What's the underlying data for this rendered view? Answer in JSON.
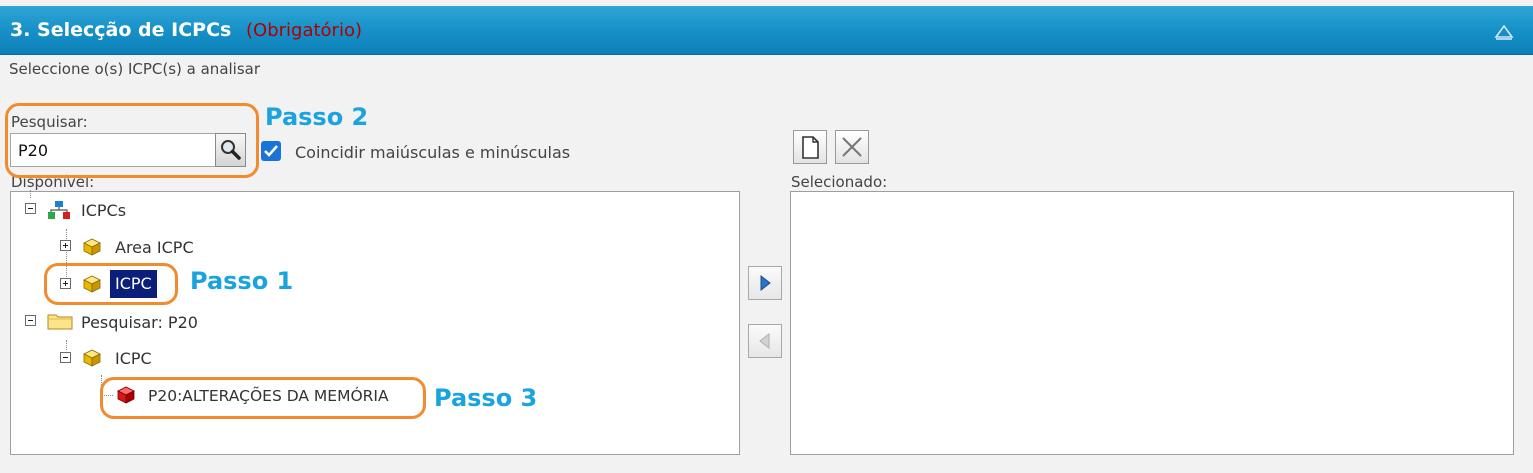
{
  "header": {
    "title": "3. Selecção de ICPCs",
    "required_label": "(Obrigatório)"
  },
  "instruction": "Seleccione o(s) ICPC(s) a analisar",
  "search": {
    "label": "Pesquisar:",
    "value": "P20"
  },
  "match_case": {
    "label": "Coincidir maiúsculas e minúsculas",
    "checked": true
  },
  "available": {
    "label": "Disponível:",
    "tree": {
      "root": "ICPCs",
      "area": "Area ICPC",
      "icpc": "ICPC",
      "search_root": "Pesquisar: P20",
      "search_group": "ICPC",
      "search_result": "P20:ALTERAÇÕES DA MEMÓRIA"
    }
  },
  "selected": {
    "label": "Selecionado:"
  },
  "annotations": {
    "step1": "Passo 1",
    "step2": "Passo 2",
    "step3": "Passo 3"
  },
  "colors": {
    "header": "#1791c8",
    "required": "#b00000",
    "selection": "#0a1e7a",
    "annotation_box": "#f28a30",
    "annotation_text": "#1aa3de"
  },
  "icons": {
    "collapse": "collapse-up-icon",
    "search": "magnifier-icon",
    "new": "new-document-icon",
    "clear": "clear-x-icon",
    "add": "arrow-right-icon",
    "remove": "arrow-left-icon"
  }
}
